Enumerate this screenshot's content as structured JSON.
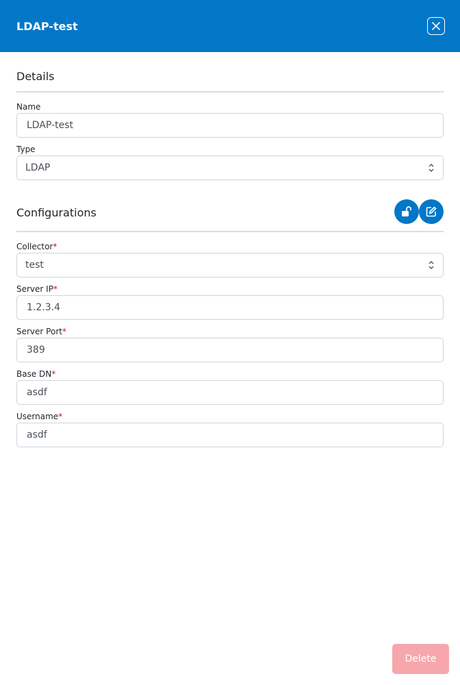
{
  "header": {
    "title": "LDAP-test",
    "close_icon": "close-icon"
  },
  "details": {
    "title": "Details",
    "name": {
      "label": "Name",
      "value": "LDAP-test"
    },
    "type": {
      "label": "Type",
      "value": "LDAP"
    }
  },
  "configurations": {
    "title": "Configurations",
    "unlock_icon": "unlock-icon",
    "edit_icon": "edit-icon",
    "collector": {
      "label": "Collector",
      "value": "test"
    },
    "server_ip": {
      "label": "Server IP",
      "value": "1.2.3.4"
    },
    "server_port": {
      "label": "Server Port",
      "value": "389"
    },
    "base_dn": {
      "label": "Base DN",
      "value": "asdf"
    },
    "username": {
      "label": "Username",
      "value": "asdf"
    },
    "required_marker": "*"
  },
  "footer": {
    "delete_label": "Delete"
  },
  "colors": {
    "primary": "#0277c8",
    "delete_bg": "#f6a7ab",
    "required": "#c8102e"
  }
}
